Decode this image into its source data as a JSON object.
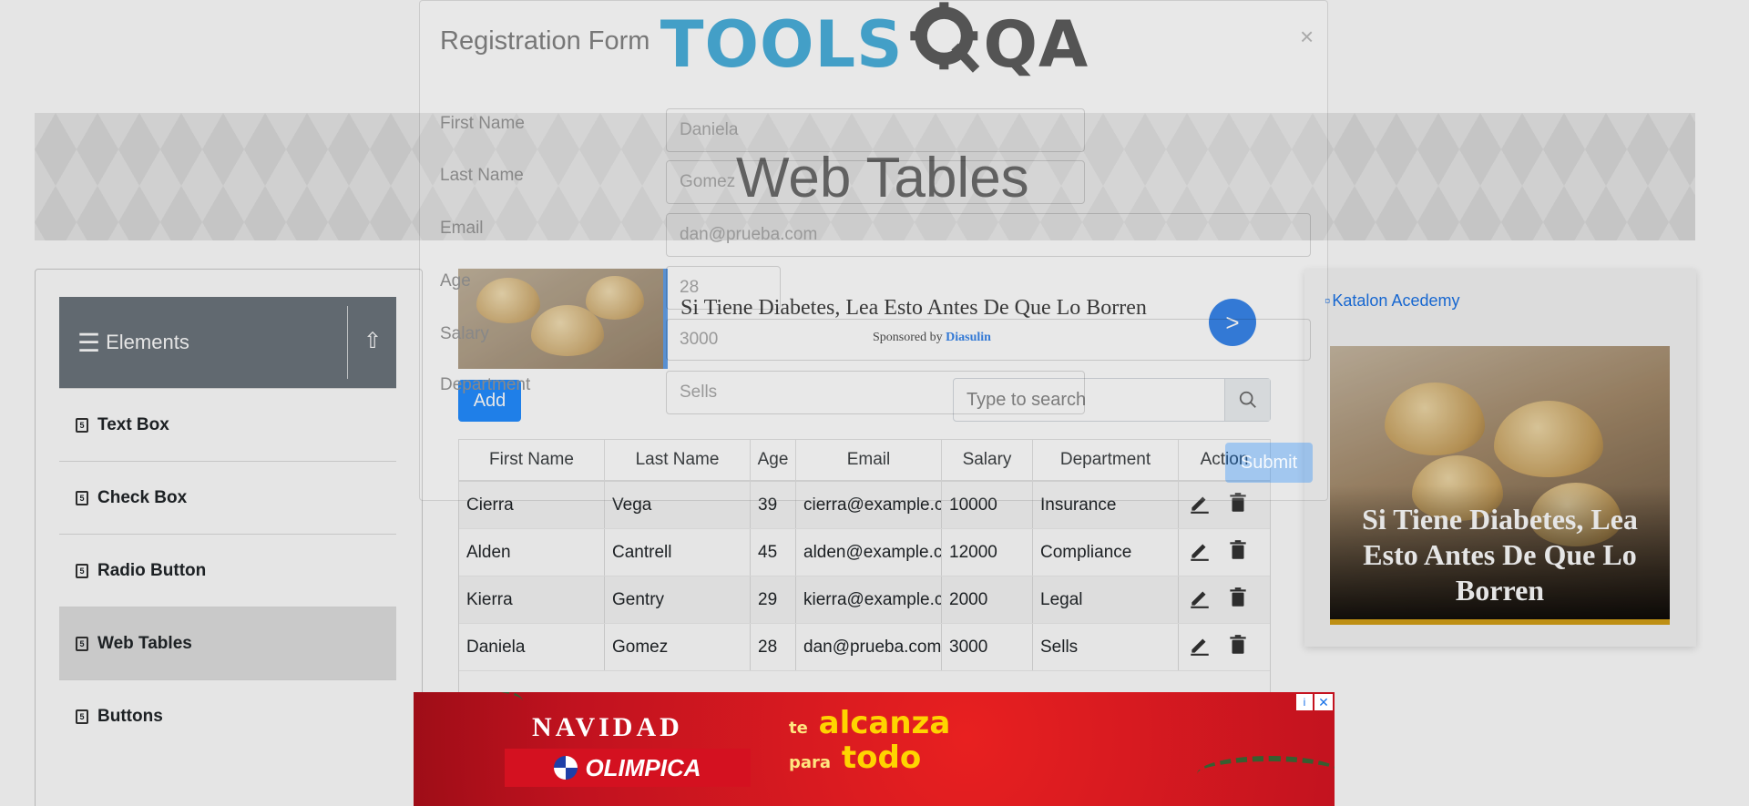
{
  "header": {
    "logo_text": "TOOLS",
    "logo_suffix": "QA"
  },
  "page": {
    "title": "Web Tables"
  },
  "sidebar": {
    "group_title": "Elements",
    "items": [
      {
        "label": "Text Box"
      },
      {
        "label": "Check Box"
      },
      {
        "label": "Radio Button"
      },
      {
        "label": "Web Tables"
      },
      {
        "label": "Buttons"
      }
    ]
  },
  "toolbar": {
    "add_label": "Add",
    "search_placeholder": "Type to search"
  },
  "table": {
    "headers": [
      "First Name",
      "Last Name",
      "Age",
      "Email",
      "Salary",
      "Department",
      "Action"
    ],
    "rows": [
      {
        "first": "Cierra",
        "last": "Vega",
        "age": "39",
        "email": "cierra@example.com",
        "salary": "10000",
        "dept": "Insurance"
      },
      {
        "first": "Alden",
        "last": "Cantrell",
        "age": "45",
        "email": "alden@example.com",
        "salary": "12000",
        "dept": "Compliance"
      },
      {
        "first": "Kierra",
        "last": "Gentry",
        "age": "29",
        "email": "kierra@example.com",
        "salary": "2000",
        "dept": "Legal"
      },
      {
        "first": "Daniela",
        "last": "Gomez",
        "age": "28",
        "email": "dan@prueba.com",
        "salary": "3000",
        "dept": "Sells"
      }
    ]
  },
  "modal": {
    "title": "Registration Form",
    "close": "×",
    "fields": [
      {
        "label": "First Name",
        "value": "Daniela"
      },
      {
        "label": "Last Name",
        "value": "Gomez"
      },
      {
        "label": "Email",
        "value": "dan@prueba.com"
      },
      {
        "label": "Age",
        "value": "28"
      },
      {
        "label": "Salary",
        "value": "3000"
      },
      {
        "label": "Department",
        "value": "Sells"
      }
    ],
    "submit_label": "Submit"
  },
  "ads": {
    "top": {
      "headline": "Si Tiene Diabetes, Lea Esto Antes De Que Lo Borren",
      "sponsored_by": "Sponsored by",
      "sponsor": "Diasulin",
      "arrow": ">"
    },
    "right": {
      "link_text": "Katalon Acedemy",
      "caption": "Si Tiene Diabetes, Lea Esto Antes De Que Lo Borren"
    },
    "bottom": {
      "navidad": "NAVIDAD",
      "brand": "OLIMPICA",
      "slogan_te": "te",
      "slogan_alcanza": "alcanza",
      "slogan_para": "para",
      "slogan_todo": "todo",
      "info": "i",
      "close": "✕"
    }
  },
  "colors": {
    "accent": "#007bff",
    "sidebar_header": "#6c757d",
    "logo_blue": "#2fa3d6",
    "ad_red": "#c1121f"
  }
}
